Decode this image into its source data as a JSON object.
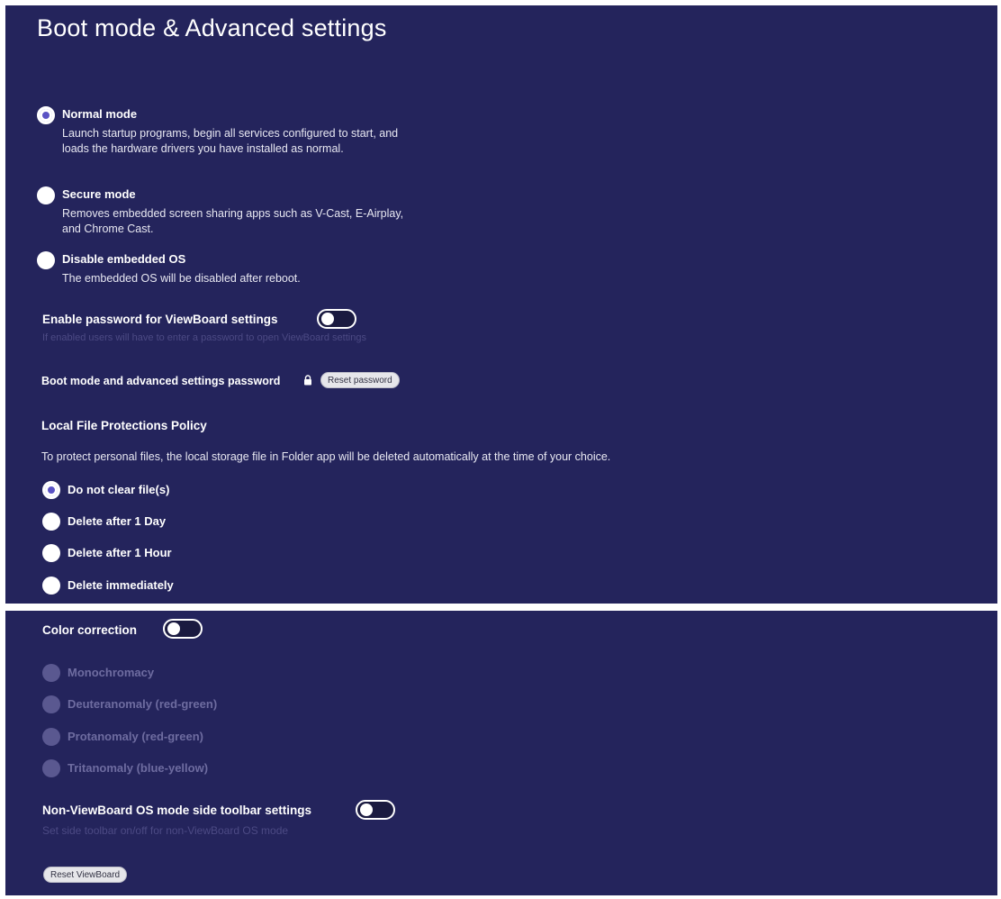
{
  "page_title": "Boot mode & Advanced settings",
  "boot_modes": [
    {
      "label": "Normal mode",
      "description": "Launch startup programs, begin all services configured to start, and loads the hardware drivers you have installed as normal.",
      "selected": true
    },
    {
      "label": "Secure mode",
      "description": "Removes embedded screen sharing apps such as V-Cast, E-Airplay, and Chrome Cast.",
      "selected": false
    },
    {
      "label": "Disable embedded OS",
      "description": "The embedded OS will be disabled after reboot.",
      "selected": false
    }
  ],
  "password_setting": {
    "label": "Enable password for ViewBoard settings",
    "hint": "If enabled users will have to enter a password to open ViewBoard settings",
    "enabled": false
  },
  "boot_password": {
    "label": "Boot mode and advanced settings password",
    "icon": "lock-icon",
    "reset_button": "Reset password"
  },
  "file_policy": {
    "title": "Local File Protections Policy",
    "description": "To protect personal files, the local storage file in Folder app will be deleted automatically at the time of your choice.",
    "options": [
      {
        "label": "Do not clear file(s)",
        "selected": true
      },
      {
        "label": "Delete after 1 Day",
        "selected": false
      },
      {
        "label": "Delete after 1 Hour",
        "selected": false
      },
      {
        "label": "Delete immediately",
        "selected": false
      }
    ]
  },
  "color_correction": {
    "label": "Color correction",
    "enabled": false,
    "options": [
      {
        "label": "Monochromacy"
      },
      {
        "label": "Deuteranomaly (red-green)"
      },
      {
        "label": "Protanomaly (red-green)"
      },
      {
        "label": "Tritanomaly (blue-yellow)"
      }
    ]
  },
  "side_toolbar": {
    "label": "Non-ViewBoard OS mode side toolbar settings",
    "hint": "Set side toolbar on/off for non-ViewBoard OS mode",
    "enabled": false
  },
  "reset_viewboard_button": "Reset ViewBoard",
  "colors": {
    "panel_background": "#24245c",
    "radio_selected": "#5a52c4",
    "disabled": "#5a5890"
  }
}
